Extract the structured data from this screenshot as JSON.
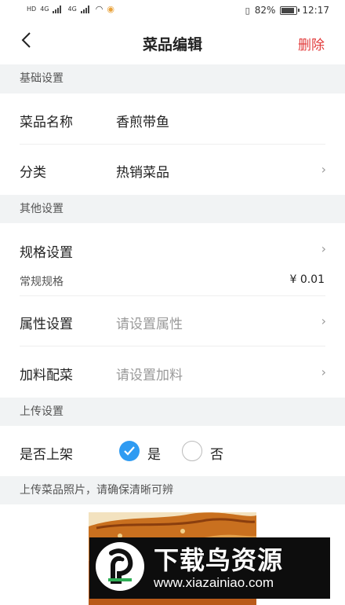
{
  "status_bar": {
    "network_left": "HD",
    "signal1": "4G",
    "signal2": "4G",
    "battery_pct": "82%",
    "time": "12:17"
  },
  "nav": {
    "back_icon": "chevron-left-icon",
    "title": "菜品编辑",
    "delete_label": "删除",
    "delete_color": "#e23a3a"
  },
  "basic": {
    "header": "基础设置",
    "name_label": "菜品名称",
    "name_value": "香煎带鱼",
    "category_label": "分类",
    "category_value": "热销菜品"
  },
  "other": {
    "header": "其他设置",
    "spec_label": "规格设置",
    "spec_sub_label": "常规规格",
    "spec_sub_price": "¥ 0.01",
    "attr_label": "属性设置",
    "attr_placeholder": "请设置属性",
    "topping_label": "加料配菜",
    "topping_placeholder": "请设置加料"
  },
  "upload": {
    "header": "上传设置",
    "onshelf_label": "是否上架",
    "yes_label": "是",
    "no_label": "否",
    "selected": "是",
    "accent_color": "#2f9bf2"
  },
  "photo": {
    "header": "上传菜品照片，请确保清晰可辨"
  },
  "watermark": {
    "title": "下载鸟资源",
    "url": "www.xiazainiao.com"
  }
}
